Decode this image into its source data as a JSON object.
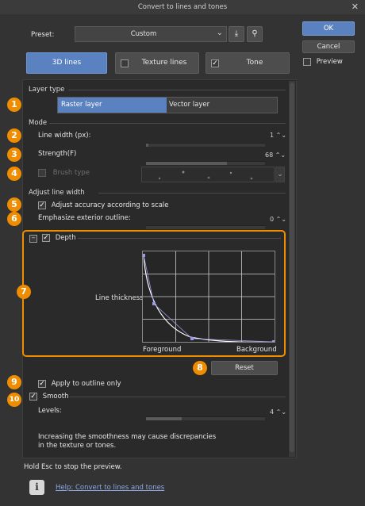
{
  "window": {
    "title": "Convert to lines and tones"
  },
  "preset": {
    "label": "Preset:",
    "value": "Custom"
  },
  "tabs": [
    {
      "label": "3D lines",
      "selected": true
    },
    {
      "label": "Texture lines",
      "checked": false
    },
    {
      "label": "Tone",
      "checked": true
    }
  ],
  "side": {
    "ok": "OK",
    "cancel": "Cancel",
    "preview": "Preview"
  },
  "layer_type": {
    "header": "Layer type",
    "raster": "Raster layer",
    "vector": "Vector layer"
  },
  "mode": {
    "header": "Mode",
    "line_width_label": "Line width (px):",
    "line_width_value": "1",
    "strength_label": "Strength(F)",
    "strength_value": "68",
    "brush_type_label": "Brush type"
  },
  "adjust": {
    "header": "Adjust line width",
    "scale_label": "Adjust accuracy according to scale",
    "emphasize_label": "Emphasize exterior outline:",
    "emphasize_value": "0"
  },
  "depth": {
    "label": "Depth",
    "y_label": "Line thickness",
    "x_left": "Foreground",
    "x_right": "Background",
    "reset": "Reset"
  },
  "outline": {
    "label": "Apply to outline only"
  },
  "smooth": {
    "label": "Smooth",
    "levels_label": "Levels:",
    "levels_value": "4",
    "note1": "Increasing the smoothness may cause discrepancies",
    "note2": "in the texture or tones."
  },
  "footer": {
    "hint": "Hold Esc to stop the preview.",
    "help": "Help: Convert to lines and tones"
  },
  "callouts": [
    "1",
    "2",
    "3",
    "4",
    "5",
    "6",
    "7",
    "8",
    "9",
    "10"
  ],
  "colors": {
    "accent": "#5b82c0",
    "callout": "#f08c00"
  }
}
